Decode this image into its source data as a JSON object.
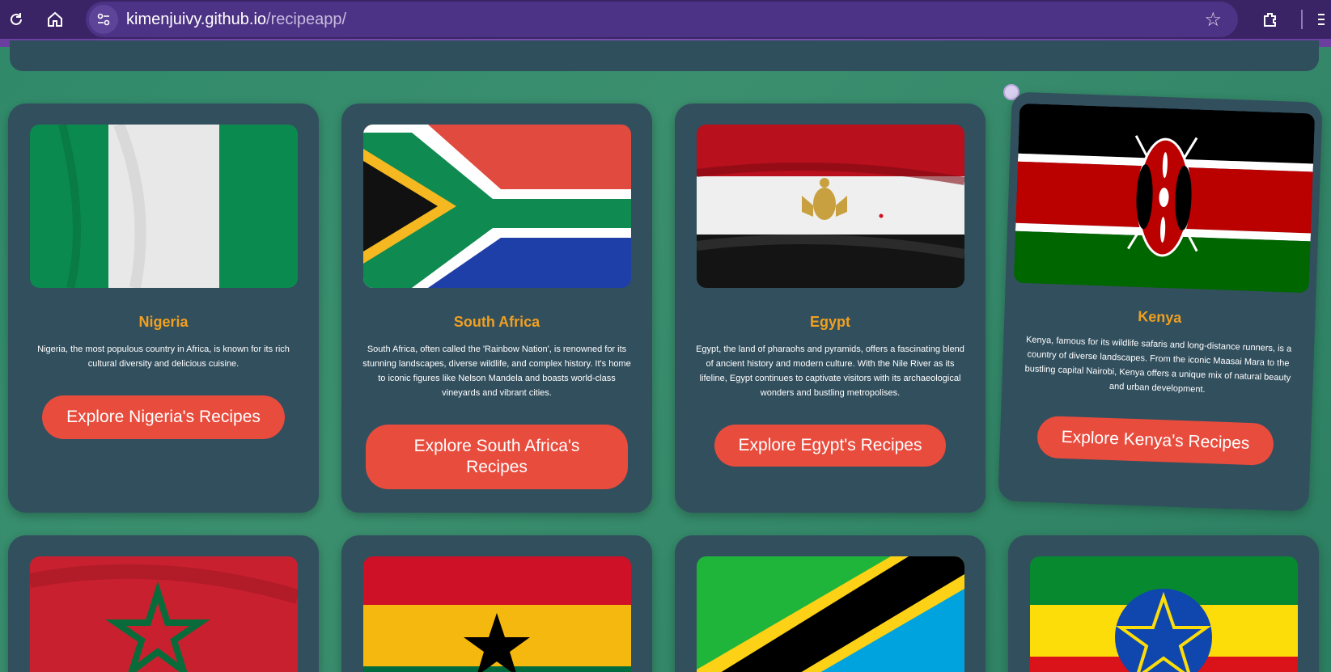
{
  "browser": {
    "url_host": "kimenjuivy.github.io",
    "url_path": "/recipeapp/"
  },
  "cards": [
    {
      "country": "Nigeria",
      "description": "Nigeria, the most populous country in Africa, is known for its rich cultural diversity and delicious cuisine.",
      "button": "Explore Nigeria's Recipes"
    },
    {
      "country": "South Africa",
      "description": "South Africa, often called the 'Rainbow Nation', is renowned for its stunning landscapes, diverse wildlife, and complex history. It's home to iconic figures like Nelson Mandela and boasts world-class vineyards and vibrant cities.",
      "button": "Explore South Africa's Recipes"
    },
    {
      "country": "Egypt",
      "description": "Egypt, the land of pharaohs and pyramids, offers a fascinating blend of ancient history and modern culture. With the Nile River as its lifeline, Egypt continues to captivate visitors with its archaeological wonders and bustling metropolises.",
      "button": "Explore Egypt's Recipes"
    },
    {
      "country": "Kenya",
      "description": "Kenya, famous for its wildlife safaris and long-distance runners, is a country of diverse landscapes. From the iconic Maasai Mara to the bustling capital Nairobi, Kenya offers a unique mix of natural beauty and urban development.",
      "button": "Explore Kenya's Recipes"
    }
  ],
  "colors": {
    "card_bg": "#324f5e",
    "title": "#f0a020",
    "button": "#e84c3d",
    "page_bg": "#2f8a6a"
  }
}
